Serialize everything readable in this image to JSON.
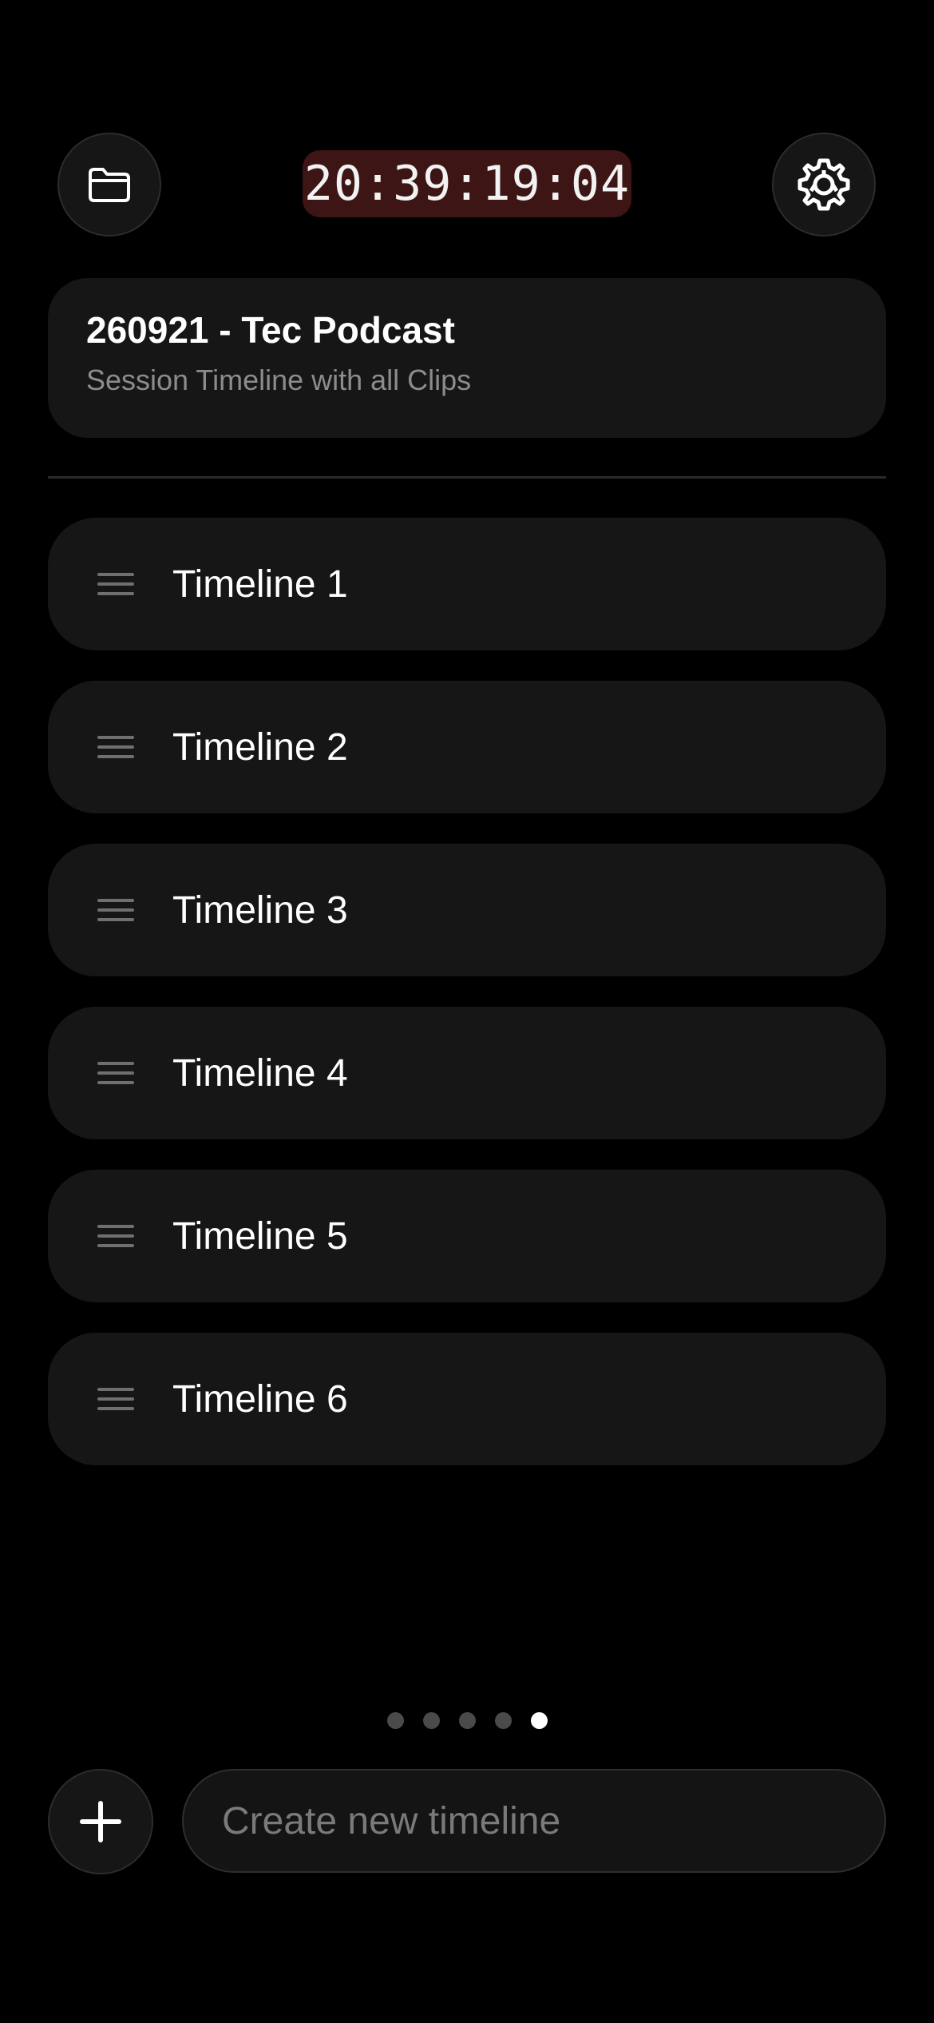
{
  "header": {
    "folder_icon": "folder-icon",
    "timecode": "20:39:19:04",
    "settings_icon": "gear-icon",
    "timecode_bg": "#3d1515"
  },
  "session": {
    "title": "260921 - Tec Podcast",
    "subtitle": "Session Timeline with all Clips"
  },
  "timelines": [
    {
      "label": "Timeline 1"
    },
    {
      "label": "Timeline 2"
    },
    {
      "label": "Timeline 3"
    },
    {
      "label": "Timeline 4"
    },
    {
      "label": "Timeline 5"
    },
    {
      "label": "Timeline 6"
    }
  ],
  "pager": {
    "pages": 5,
    "current_page": 5
  },
  "footer": {
    "add_icon": "plus-icon",
    "input_placeholder": "Create new timeline",
    "input_value": ""
  }
}
